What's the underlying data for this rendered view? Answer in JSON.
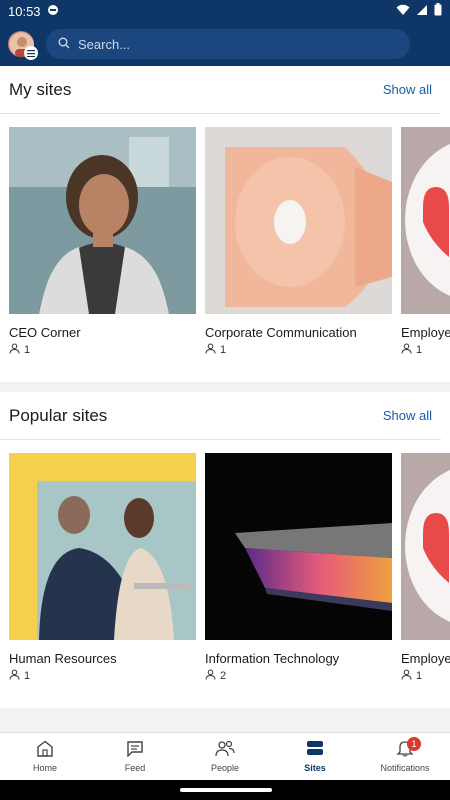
{
  "status_bar": {
    "time": "10:53"
  },
  "header": {
    "search_placeholder": "Search..."
  },
  "my_sites": {
    "title": "My sites",
    "show_all": "Show all",
    "cards": [
      {
        "name": "CEO Corner",
        "members": "1"
      },
      {
        "name": "Corporate Communication",
        "members": "1"
      },
      {
        "name": "Employe",
        "members": "1"
      }
    ]
  },
  "popular_sites": {
    "title": "Popular sites",
    "show_all": "Show all",
    "cards": [
      {
        "name": "Human Resources",
        "members": "1"
      },
      {
        "name": "Information Technology",
        "members": "2"
      },
      {
        "name": "Employe",
        "members": "1"
      }
    ]
  },
  "nav": {
    "items": [
      {
        "label": "Home",
        "icon": "home-icon"
      },
      {
        "label": "Feed",
        "icon": "feed-icon"
      },
      {
        "label": "People",
        "icon": "people-icon"
      },
      {
        "label": "Sites",
        "icon": "sites-icon"
      },
      {
        "label": "Notifications",
        "icon": "bell-icon",
        "badge": "1"
      }
    ],
    "active": "Sites"
  },
  "colors": {
    "brand": "#0e3667",
    "accent": "#1b5aa7",
    "badge": "#d93b30"
  }
}
